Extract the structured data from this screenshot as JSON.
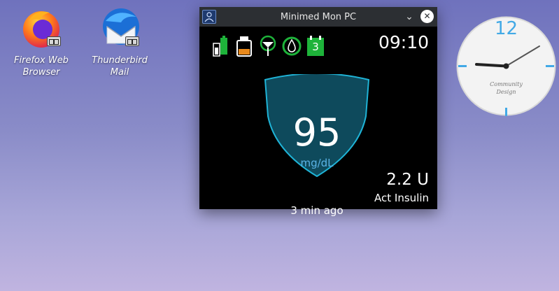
{
  "desktop": {
    "icons": [
      {
        "label_line1": "Firefox Web",
        "label_line2": "Browser"
      },
      {
        "label_line1": "Thunderbird",
        "label_line2": "Mail"
      }
    ]
  },
  "window": {
    "title": "Minimed Mon PC",
    "minimize_glyph": "⌄",
    "close_glyph": "✕"
  },
  "monitor": {
    "time": "09:10",
    "glucose_value": "95",
    "glucose_unit": "mg/dL",
    "last_reading": "3 min ago",
    "active_insulin_value": "2.2 U",
    "active_insulin_label": "Act Insulin",
    "calendar_badge": "3",
    "status_icons": [
      "battery-icon",
      "insulin-reservoir-icon",
      "sensor-signal-icon",
      "sensor-status-icon",
      "calendar-icon"
    ]
  },
  "clock_widget": {
    "numeral_12": "12",
    "brand_line1": "Community",
    "brand_line2": "Design"
  },
  "colors": {
    "window_bg": "#000000",
    "titlebar": "#2c2f33",
    "shield_fill": "#0e4a5c",
    "shield_stroke": "#1fb3d6",
    "unit_text": "#5ab3e6",
    "green_status": "#1eb33a",
    "orange_reservoir": "#e8891c"
  }
}
